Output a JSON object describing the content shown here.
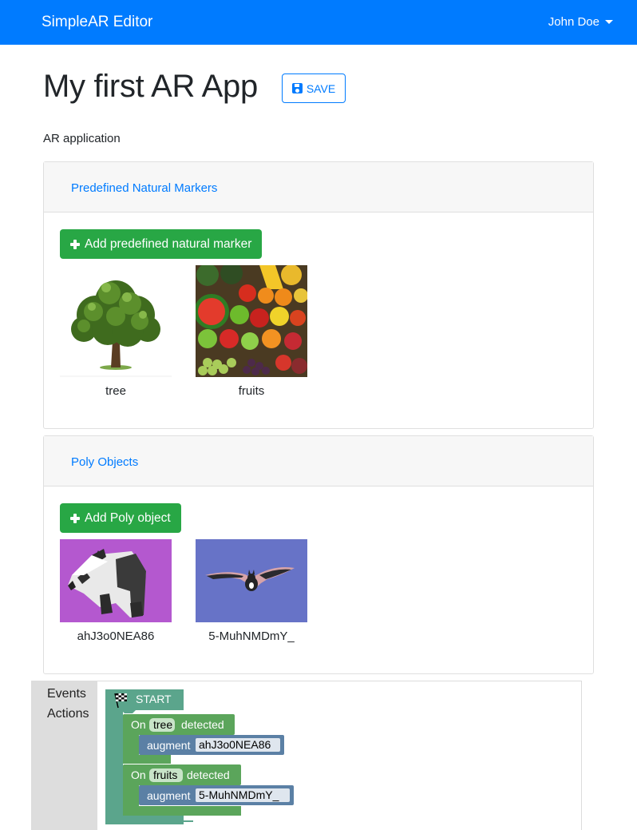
{
  "navbar": {
    "brand": "SimpleAR Editor",
    "user": "John Doe",
    "color": "#007bff"
  },
  "page": {
    "title": "My first AR App",
    "save_label": "SAVE",
    "subtitle": "AR application"
  },
  "markers": {
    "header": "Predefined Natural Markers",
    "add_label": "Add predefined natural marker",
    "items": [
      {
        "label": "tree",
        "image": "tree-image"
      },
      {
        "label": "fruits",
        "image": "fruits-image"
      }
    ]
  },
  "poly": {
    "header": "Poly Objects",
    "add_label": "Add Poly object",
    "items": [
      {
        "label": "ahJ3o0NEA86",
        "image": "panda-image"
      },
      {
        "label": "5-MuhNMDmY_",
        "image": "bat-image"
      }
    ]
  },
  "blockly": {
    "toolbox": [
      "Events",
      "Actions"
    ],
    "start_label": "START",
    "events": [
      {
        "on": "On",
        "marker": "tree",
        "detected": "detected",
        "action": "augment",
        "object": "ahJ3o0NEA86"
      },
      {
        "on": "On",
        "marker": "fruits",
        "detected": "detected",
        "action": "augment",
        "object": "5-MuhNMDmY_"
      }
    ],
    "colors": {
      "start": "#5ba58c",
      "event": "#5ba55b",
      "action": "#5b80a5"
    }
  },
  "colors": {
    "primary": "#007bff",
    "success": "#28a745"
  }
}
